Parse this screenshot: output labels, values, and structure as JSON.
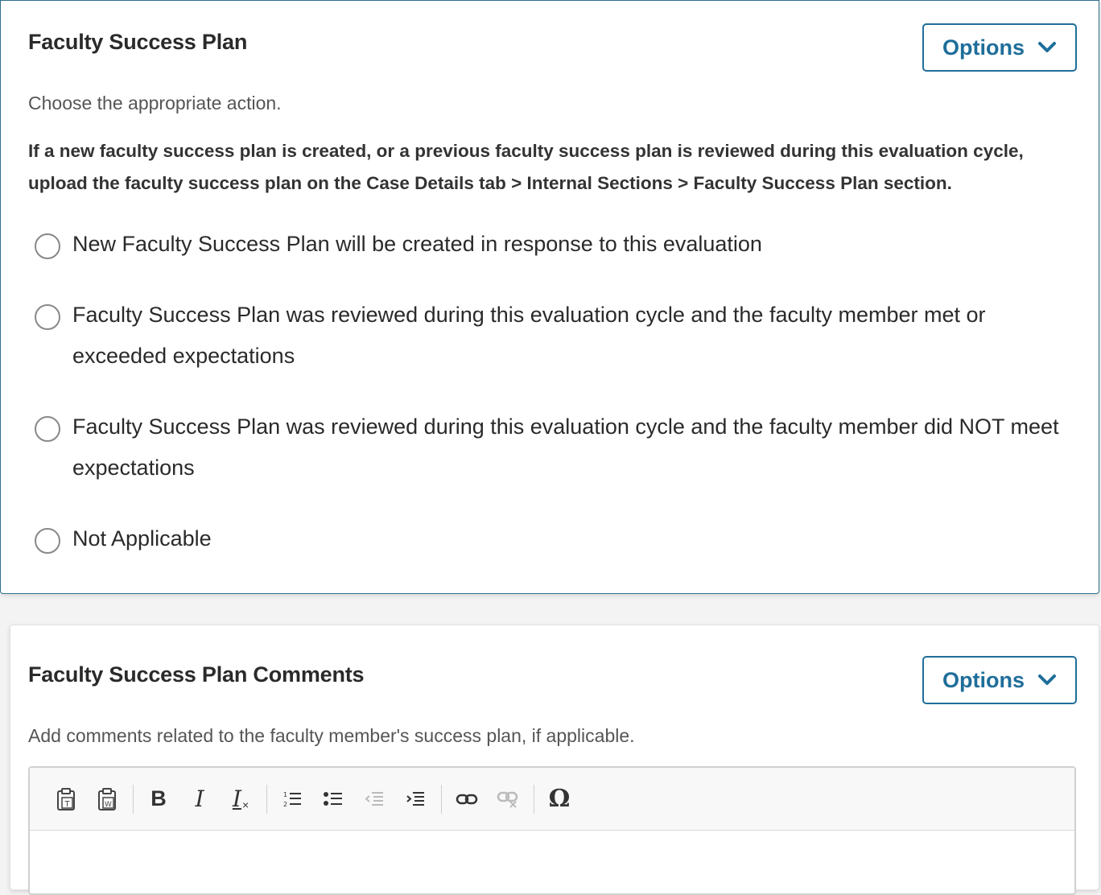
{
  "success_plan": {
    "title": "Faculty Success Plan",
    "options_label": "Options",
    "helper": "Choose the appropriate action.",
    "instructions": "If a new faculty success plan is created, or a previous faculty success plan is reviewed during this evaluation cycle, upload the faculty success plan on the Case Details tab > Internal Sections > Faculty Success Plan section.",
    "choices": [
      {
        "label": "New Faculty Success Plan will be created in response to this evaluation",
        "selected": false
      },
      {
        "label": "Faculty Success Plan was reviewed during this evaluation cycle and the faculty member met or exceeded expectations",
        "selected": false
      },
      {
        "label": "Faculty Success Plan was reviewed during this evaluation cycle and the faculty member did NOT meet expectations",
        "selected": false
      },
      {
        "label": "Not Applicable",
        "selected": false
      }
    ]
  },
  "comments": {
    "title": "Faculty Success Plan Comments",
    "options_label": "Options",
    "helper": "Add comments related to the faculty member's success plan, if applicable.",
    "toolbar": {
      "bold": "B",
      "italic": "I",
      "remove_format": "I",
      "special_char": "Ω",
      "icons": [
        "paste-text-icon",
        "paste-word-icon",
        "bold-icon",
        "italic-icon",
        "remove-format-icon",
        "numbered-list-icon",
        "bulleted-list-icon",
        "outdent-icon",
        "indent-icon",
        "link-icon",
        "unlink-icon",
        "special-character-icon"
      ]
    }
  },
  "colors": {
    "accent": "#1f6e9a",
    "card_border_active": "#2d6f8f",
    "text": "#2a2a2a",
    "muted": "#555555"
  }
}
